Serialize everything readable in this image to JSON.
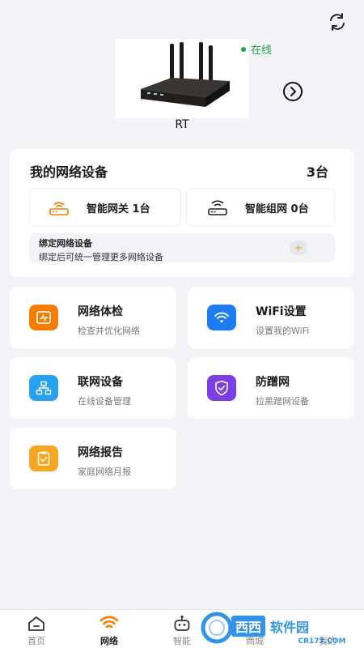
{
  "header": {
    "refresh_icon": "refresh-icon",
    "status": "在线",
    "status_color": "#1fa34a",
    "device_name": "RT"
  },
  "devices": {
    "title": "我的网络设备",
    "count": "3台",
    "gateway_label": "智能网关 1台",
    "mesh_label": "智能组网 0台",
    "bind_title": "绑定网络设备",
    "bind_desc": "绑定后可统一管理更多网络设备",
    "bind_add": "+"
  },
  "features": [
    {
      "title": "网络体检",
      "desc": "检查并优化网络",
      "icon": "checkup-icon",
      "color": "#f57c00"
    },
    {
      "title": "WiFi设置",
      "desc": "设置我的WiFi",
      "icon": "wifi-icon",
      "color": "#1e7cf2"
    },
    {
      "title": "联网设备",
      "desc": "在线设备管理",
      "icon": "network-devices-icon",
      "color": "#27a2f0"
    },
    {
      "title": "防蹭网",
      "desc": "拉黑蹭网设备",
      "icon": "shield-icon",
      "color": "#7b3fe4"
    },
    {
      "title": "网络报告",
      "desc": "家庭网络月报",
      "icon": "report-icon",
      "color": "#f5a623"
    }
  ],
  "tabbar": {
    "tabs": [
      {
        "label": "首页",
        "icon": "home-icon"
      },
      {
        "label": "网络",
        "icon": "wifi-icon"
      },
      {
        "label": "智能",
        "icon": "robot-icon"
      },
      {
        "label": "商城",
        "icon": "shop-icon"
      },
      {
        "label": "我的",
        "icon": "profile-icon"
      }
    ],
    "active_color": "#f57c00"
  },
  "watermark": {
    "text_cn": "西西软件园",
    "text_en": "CR173.COM"
  }
}
